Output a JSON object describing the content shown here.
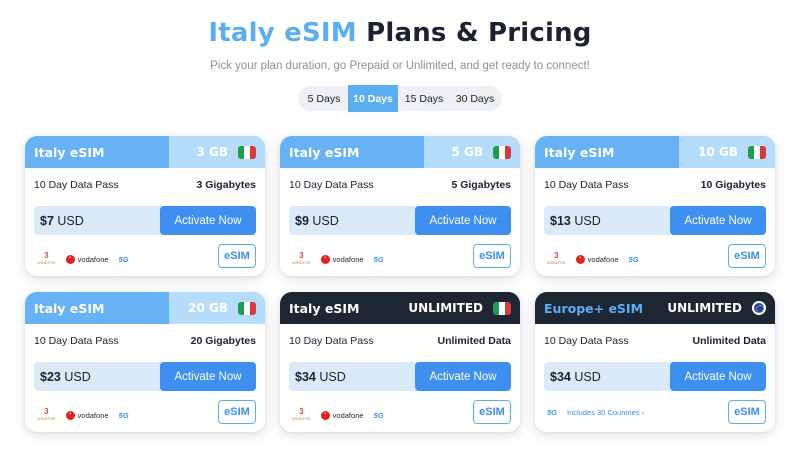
{
  "header": {
    "title_accent": "Italy eSIM",
    "title_rest": "Plans & Pricing",
    "subtitle": "Pick your plan duration, go Prepaid or Unlimited, and get ready to connect!"
  },
  "tabs": [
    {
      "label": "5 Days",
      "active": false
    },
    {
      "label": "10 Days",
      "active": true
    },
    {
      "label": "15 Days",
      "active": false
    },
    {
      "label": "30 Days",
      "active": false
    }
  ],
  "cards": [
    {
      "name": "Italy eSIM",
      "data_label": "3 GB",
      "flag": "italy-flag",
      "pass": "10 Day Data Pass",
      "amount": "3 Gigabytes",
      "price": "$7",
      "currency": "USD",
      "button": "Activate Now",
      "badge": "eSIM",
      "carriers": [
        "3",
        "vodafone",
        "5G"
      ],
      "theme": "light"
    },
    {
      "name": "Italy eSIM",
      "data_label": "5 GB",
      "flag": "italy-flag",
      "pass": "10 Day Data Pass",
      "amount": "5 Gigabytes",
      "price": "$9",
      "currency": "USD",
      "button": "Activate Now",
      "badge": "eSIM",
      "carriers": [
        "3",
        "vodafone",
        "5G"
      ],
      "theme": "light"
    },
    {
      "name": "Italy eSIM",
      "data_label": "10 GB",
      "flag": "italy-flag",
      "pass": "10 Day Data Pass",
      "amount": "10 Gigabytes",
      "price": "$13",
      "currency": "USD",
      "button": "Activate Now",
      "badge": "eSIM",
      "carriers": [
        "3",
        "vodafone",
        "5G"
      ],
      "theme": "light"
    },
    {
      "name": "Italy eSIM",
      "data_label": "20 GB",
      "flag": "italy-flag",
      "pass": "10 Day Data Pass",
      "amount": "20 Gigabytes",
      "price": "$23",
      "currency": "USD",
      "button": "Activate Now",
      "badge": "eSIM",
      "carriers": [
        "3",
        "vodafone",
        "5G"
      ],
      "theme": "light"
    },
    {
      "name": "Italy eSIM",
      "data_label": "UNLIMITED",
      "flag": "italy-flag",
      "pass": "10 Day Data Pass",
      "amount": "Unlimited Data",
      "price": "$34",
      "currency": "USD",
      "button": "Activate Now",
      "badge": "eSIM",
      "carriers": [
        "3",
        "vodafone",
        "5G"
      ],
      "theme": "dark"
    },
    {
      "name": "Europe+ eSIM",
      "data_label": "UNLIMITED",
      "flag": "eu-flag",
      "pass": "10 Day Data Pass",
      "amount": "Unlimited Data",
      "price": "$34",
      "currency": "USD",
      "button": "Activate Now",
      "badge": "eSIM",
      "carriers": [
        "5G"
      ],
      "coverage_link": "Includes 30 Countries ›",
      "theme": "dark"
    }
  ],
  "carrier_text": {
    "three": "3",
    "three_sub": "WINDTRE",
    "vodafone": "vodafone",
    "five_g": "5G"
  },
  "colors": {
    "accent": "#5aaef2",
    "button": "#3d8ff0",
    "dark_header": "#1e2533",
    "price_bg": "#dbeaf8"
  }
}
